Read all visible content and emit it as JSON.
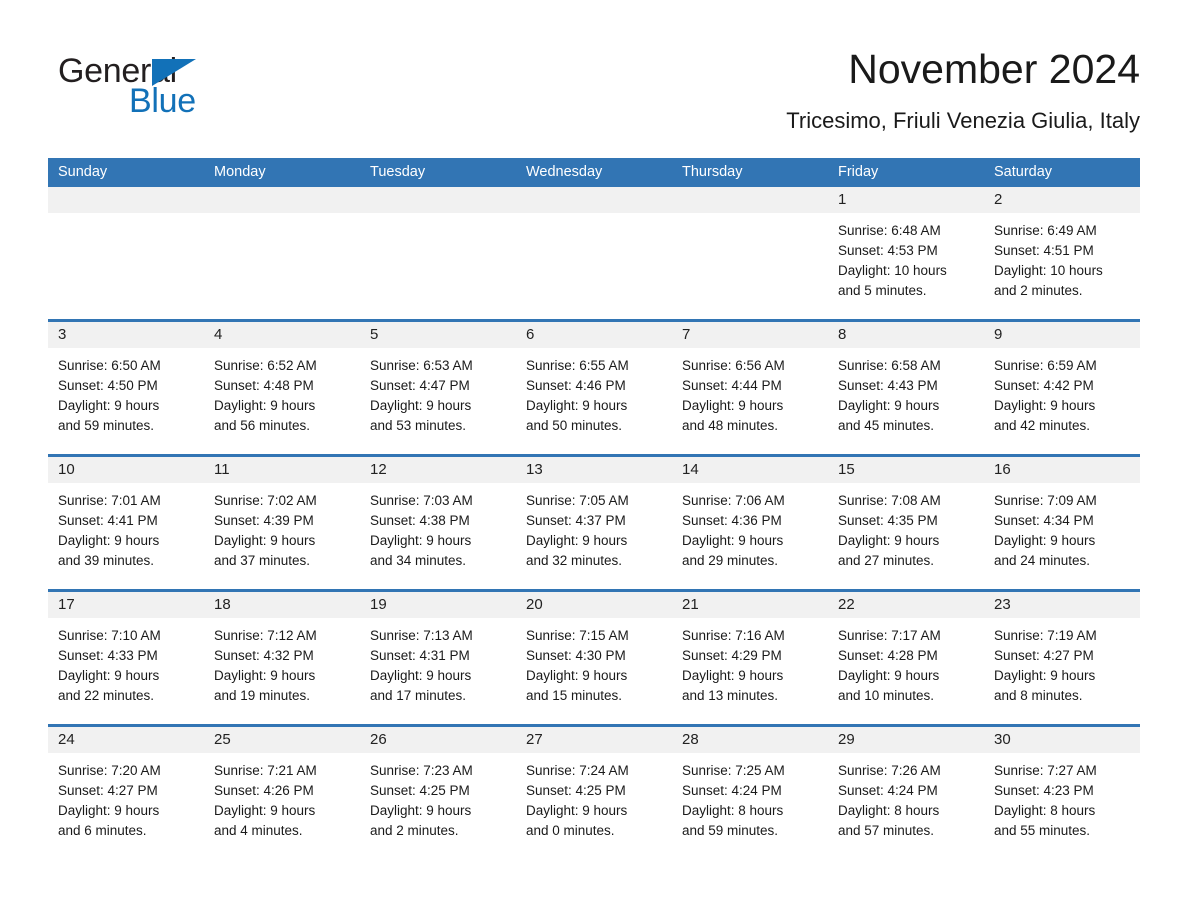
{
  "brand": {
    "name_part1": "General",
    "name_part2": "Blue",
    "accent_color": "#1271b8"
  },
  "header": {
    "month_title": "November 2024",
    "location": "Tricesimo, Friuli Venezia Giulia, Italy"
  },
  "theme": {
    "header_blue": "#3275b4",
    "daynum_band": "#f1f1f1",
    "cell_bg": "#ffffff",
    "text": "#1a1a1a"
  },
  "weekdays": [
    "Sunday",
    "Monday",
    "Tuesday",
    "Wednesday",
    "Thursday",
    "Friday",
    "Saturday"
  ],
  "weeks": [
    [
      {
        "day": "",
        "lines": []
      },
      {
        "day": "",
        "lines": []
      },
      {
        "day": "",
        "lines": []
      },
      {
        "day": "",
        "lines": []
      },
      {
        "day": "",
        "lines": []
      },
      {
        "day": "1",
        "lines": [
          "Sunrise: 6:48 AM",
          "Sunset: 4:53 PM",
          "Daylight: 10 hours",
          "and 5 minutes."
        ]
      },
      {
        "day": "2",
        "lines": [
          "Sunrise: 6:49 AM",
          "Sunset: 4:51 PM",
          "Daylight: 10 hours",
          "and 2 minutes."
        ]
      }
    ],
    [
      {
        "day": "3",
        "lines": [
          "Sunrise: 6:50 AM",
          "Sunset: 4:50 PM",
          "Daylight: 9 hours",
          "and 59 minutes."
        ]
      },
      {
        "day": "4",
        "lines": [
          "Sunrise: 6:52 AM",
          "Sunset: 4:48 PM",
          "Daylight: 9 hours",
          "and 56 minutes."
        ]
      },
      {
        "day": "5",
        "lines": [
          "Sunrise: 6:53 AM",
          "Sunset: 4:47 PM",
          "Daylight: 9 hours",
          "and 53 minutes."
        ]
      },
      {
        "day": "6",
        "lines": [
          "Sunrise: 6:55 AM",
          "Sunset: 4:46 PM",
          "Daylight: 9 hours",
          "and 50 minutes."
        ]
      },
      {
        "day": "7",
        "lines": [
          "Sunrise: 6:56 AM",
          "Sunset: 4:44 PM",
          "Daylight: 9 hours",
          "and 48 minutes."
        ]
      },
      {
        "day": "8",
        "lines": [
          "Sunrise: 6:58 AM",
          "Sunset: 4:43 PM",
          "Daylight: 9 hours",
          "and 45 minutes."
        ]
      },
      {
        "day": "9",
        "lines": [
          "Sunrise: 6:59 AM",
          "Sunset: 4:42 PM",
          "Daylight: 9 hours",
          "and 42 minutes."
        ]
      }
    ],
    [
      {
        "day": "10",
        "lines": [
          "Sunrise: 7:01 AM",
          "Sunset: 4:41 PM",
          "Daylight: 9 hours",
          "and 39 minutes."
        ]
      },
      {
        "day": "11",
        "lines": [
          "Sunrise: 7:02 AM",
          "Sunset: 4:39 PM",
          "Daylight: 9 hours",
          "and 37 minutes."
        ]
      },
      {
        "day": "12",
        "lines": [
          "Sunrise: 7:03 AM",
          "Sunset: 4:38 PM",
          "Daylight: 9 hours",
          "and 34 minutes."
        ]
      },
      {
        "day": "13",
        "lines": [
          "Sunrise: 7:05 AM",
          "Sunset: 4:37 PM",
          "Daylight: 9 hours",
          "and 32 minutes."
        ]
      },
      {
        "day": "14",
        "lines": [
          "Sunrise: 7:06 AM",
          "Sunset: 4:36 PM",
          "Daylight: 9 hours",
          "and 29 minutes."
        ]
      },
      {
        "day": "15",
        "lines": [
          "Sunrise: 7:08 AM",
          "Sunset: 4:35 PM",
          "Daylight: 9 hours",
          "and 27 minutes."
        ]
      },
      {
        "day": "16",
        "lines": [
          "Sunrise: 7:09 AM",
          "Sunset: 4:34 PM",
          "Daylight: 9 hours",
          "and 24 minutes."
        ]
      }
    ],
    [
      {
        "day": "17",
        "lines": [
          "Sunrise: 7:10 AM",
          "Sunset: 4:33 PM",
          "Daylight: 9 hours",
          "and 22 minutes."
        ]
      },
      {
        "day": "18",
        "lines": [
          "Sunrise: 7:12 AM",
          "Sunset: 4:32 PM",
          "Daylight: 9 hours",
          "and 19 minutes."
        ]
      },
      {
        "day": "19",
        "lines": [
          "Sunrise: 7:13 AM",
          "Sunset: 4:31 PM",
          "Daylight: 9 hours",
          "and 17 minutes."
        ]
      },
      {
        "day": "20",
        "lines": [
          "Sunrise: 7:15 AM",
          "Sunset: 4:30 PM",
          "Daylight: 9 hours",
          "and 15 minutes."
        ]
      },
      {
        "day": "21",
        "lines": [
          "Sunrise: 7:16 AM",
          "Sunset: 4:29 PM",
          "Daylight: 9 hours",
          "and 13 minutes."
        ]
      },
      {
        "day": "22",
        "lines": [
          "Sunrise: 7:17 AM",
          "Sunset: 4:28 PM",
          "Daylight: 9 hours",
          "and 10 minutes."
        ]
      },
      {
        "day": "23",
        "lines": [
          "Sunrise: 7:19 AM",
          "Sunset: 4:27 PM",
          "Daylight: 9 hours",
          "and 8 minutes."
        ]
      }
    ],
    [
      {
        "day": "24",
        "lines": [
          "Sunrise: 7:20 AM",
          "Sunset: 4:27 PM",
          "Daylight: 9 hours",
          "and 6 minutes."
        ]
      },
      {
        "day": "25",
        "lines": [
          "Sunrise: 7:21 AM",
          "Sunset: 4:26 PM",
          "Daylight: 9 hours",
          "and 4 minutes."
        ]
      },
      {
        "day": "26",
        "lines": [
          "Sunrise: 7:23 AM",
          "Sunset: 4:25 PM",
          "Daylight: 9 hours",
          "and 2 minutes."
        ]
      },
      {
        "day": "27",
        "lines": [
          "Sunrise: 7:24 AM",
          "Sunset: 4:25 PM",
          "Daylight: 9 hours",
          "and 0 minutes."
        ]
      },
      {
        "day": "28",
        "lines": [
          "Sunrise: 7:25 AM",
          "Sunset: 4:24 PM",
          "Daylight: 8 hours",
          "and 59 minutes."
        ]
      },
      {
        "day": "29",
        "lines": [
          "Sunrise: 7:26 AM",
          "Sunset: 4:24 PM",
          "Daylight: 8 hours",
          "and 57 minutes."
        ]
      },
      {
        "day": "30",
        "lines": [
          "Sunrise: 7:27 AM",
          "Sunset: 4:23 PM",
          "Daylight: 8 hours",
          "and 55 minutes."
        ]
      }
    ]
  ]
}
